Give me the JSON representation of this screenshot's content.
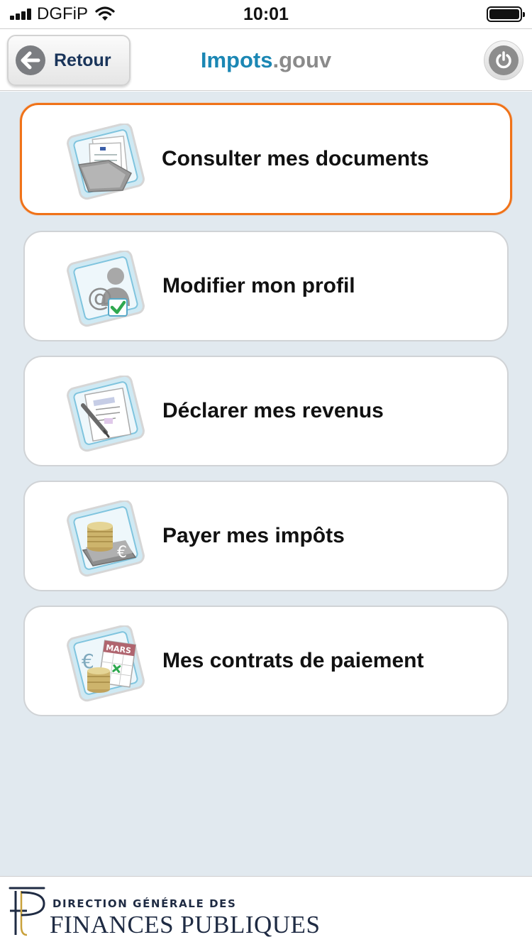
{
  "status_bar": {
    "carrier": "DGFiP",
    "time": "10:01"
  },
  "nav": {
    "back_label": "Retour",
    "brand_primary": "Impots",
    "brand_secondary": ".gouv"
  },
  "menu": [
    {
      "label": "Consulter mes documents",
      "icon": "documents-folder-icon",
      "selected": true
    },
    {
      "label": "Modifier mon profil",
      "icon": "profile-icon",
      "selected": false
    },
    {
      "label": "Déclarer mes revenus",
      "icon": "declaration-icon",
      "selected": false
    },
    {
      "label": "Payer mes impôts",
      "icon": "payment-coins-icon",
      "selected": false
    },
    {
      "label": "Mes contrats de paiement",
      "icon": "calendar-contract-icon",
      "selected": false
    }
  ],
  "menu_icon_texts": {
    "calendar_month": "MARS"
  },
  "footer": {
    "line1": "DIRECTION GÉNÉRALE DES",
    "line2": "FINANCES PUBLIQUES"
  },
  "colors": {
    "selected_border": "#f07218",
    "brand_blue": "#1b87b4",
    "brand_gray": "#8a8a8a",
    "background": "#e1e9ef",
    "footer_text": "#1f2b43"
  }
}
